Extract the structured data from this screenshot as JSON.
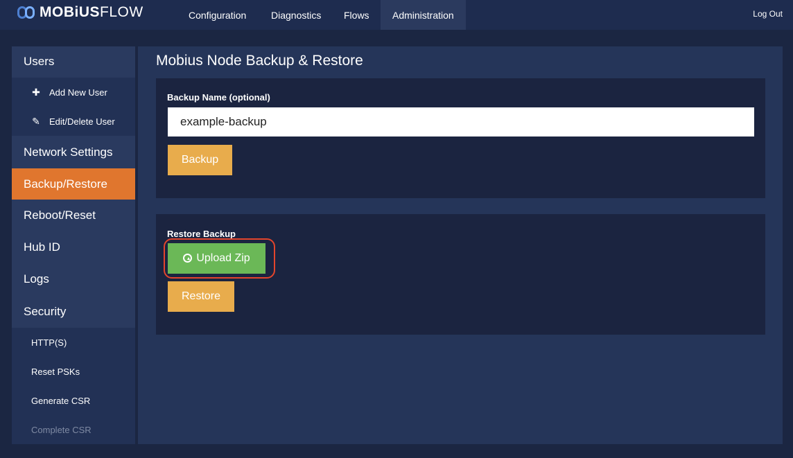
{
  "app": {
    "logo_bold": "MOBiUS",
    "logo_light": "FLOW"
  },
  "nav": {
    "tabs": [
      {
        "label": "Configuration"
      },
      {
        "label": "Diagnostics"
      },
      {
        "label": "Flows"
      },
      {
        "label": "Administration",
        "active": true
      }
    ],
    "logout": "Log Out"
  },
  "sidebar": {
    "items": [
      {
        "label": "Users"
      },
      {
        "label": "Add New User",
        "icon": "plus-icon"
      },
      {
        "label": "Edit/Delete User",
        "icon": "pencil-icon"
      },
      {
        "label": "Network Settings"
      },
      {
        "label": "Backup/Restore",
        "active": true
      },
      {
        "label": "Reboot/Reset"
      },
      {
        "label": "Hub ID"
      },
      {
        "label": "Logs"
      },
      {
        "label": "Security"
      },
      {
        "label": "HTTP(S)"
      },
      {
        "label": "Reset PSKs"
      },
      {
        "label": "Generate CSR"
      },
      {
        "label": "Complete CSR",
        "disabled": true
      }
    ]
  },
  "main": {
    "title": "Mobius Node Backup & Restore",
    "backup": {
      "label": "Backup Name (optional)",
      "value": "example-backup",
      "button": "Backup"
    },
    "restore": {
      "label": "Restore Backup",
      "upload_button": "Upload Zip",
      "upload_icon": "upload-circle-icon",
      "restore_button": "Restore"
    }
  },
  "colors": {
    "accent_active": "#e0762e",
    "button_yellow": "#e8ac4c",
    "button_green": "#6bb857",
    "highlight": "#e4452c"
  }
}
